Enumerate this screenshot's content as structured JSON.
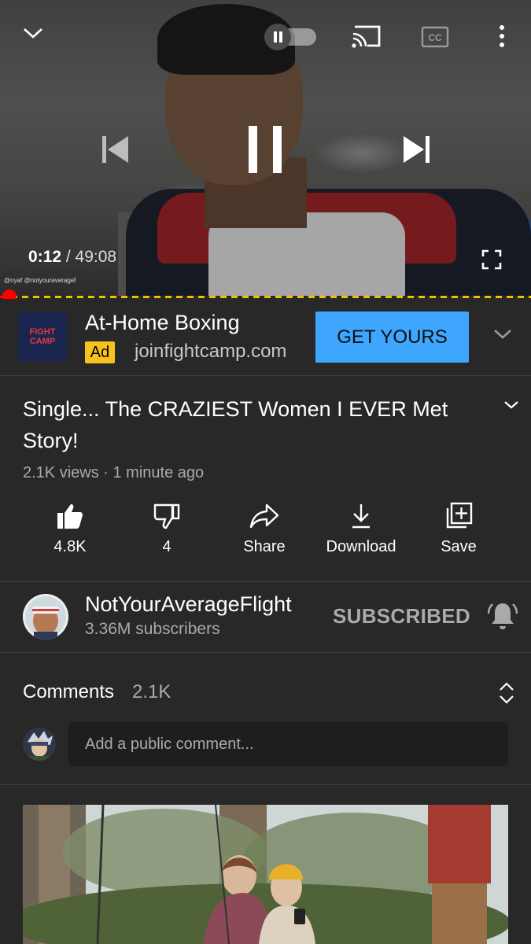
{
  "player": {
    "current_time": "0:12",
    "duration": "/ 49:08",
    "progress_fraction": 0.004,
    "watermark": "@nyaf @notyouraveragef"
  },
  "ad": {
    "logo_line1": "FIGHT",
    "logo_line2": "CAMP",
    "title": "At-Home Boxing",
    "badge": "Ad",
    "domain": "joinfightcamp.com",
    "cta": "GET YOURS"
  },
  "video": {
    "title": "Single... The CRAZIEST Women I EVER Met Story!",
    "meta": "2.1K views · 1 minute ago"
  },
  "actions": {
    "like": "4.8K",
    "dislike": "4",
    "share": "Share",
    "download": "Download",
    "save": "Save"
  },
  "channel": {
    "name": "NotYourAverageFlight",
    "subscribers": "3.36M subscribers",
    "subscribe_state": "SUBSCRIBED"
  },
  "comments": {
    "label": "Comments",
    "count": "2.1K",
    "placeholder": "Add a public comment..."
  },
  "colors": {
    "background": "#282828",
    "cta_blue": "#3ea6ff",
    "ad_badge": "#f7c21b",
    "progress_red": "#ff0000",
    "ad_marker_yellow": "#f0c000"
  }
}
